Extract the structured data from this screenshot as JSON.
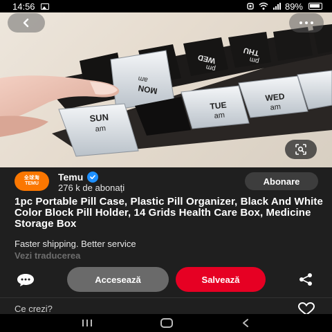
{
  "status_bar": {
    "time": "14:56",
    "battery": "89%"
  },
  "creator": {
    "name": "Temu",
    "avatar_text_line1": "全球淘",
    "avatar_text_line2": "TEMU",
    "followers": "276 k de abonați",
    "subscribe_label": "Abonare",
    "verified": true
  },
  "pin": {
    "title": "1pc Portable Pill Case, Plastic Pill Organizer, Black And White Color Block Pill Holder, 14 Grids Health Care Box, Medicine Storage Box",
    "description": "Faster shipping. Better service",
    "translate_label": "Vezi traducerea"
  },
  "photo_labels": {
    "sun": "SUN",
    "am": "am",
    "mon": "MON",
    "tue": "TUE",
    "wed": "WED",
    "thu": "THU",
    "pm": "pm"
  },
  "actions": {
    "visit_label": "Accesează",
    "save_label": "Salvează"
  },
  "comments": {
    "prompt": "Ce crezi?"
  },
  "colors": {
    "save": "#e60023",
    "brand": "#fb7701",
    "background": "#1f1f1f"
  },
  "icons": [
    "back-icon",
    "more-icon",
    "visual-search-icon",
    "verified-icon",
    "comment-icon",
    "share-icon",
    "heart-icon"
  ]
}
